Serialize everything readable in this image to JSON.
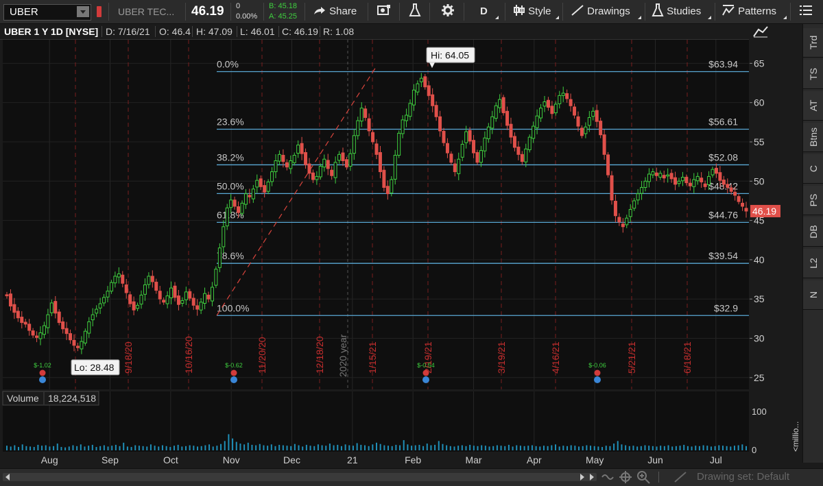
{
  "toolbar": {
    "symbol": "UBER",
    "description": "UBER TEC...",
    "last_price": "46.19",
    "net_change": "0",
    "net_change_pct": "0.00%",
    "bid": "B: 45.18",
    "ask": "A: 45.25",
    "share_label": "Share",
    "aggregation": "D",
    "style_label": "Style",
    "drawings_label": "Drawings",
    "studies_label": "Studies",
    "patterns_label": "Patterns",
    "colors": {
      "bid": "#3fcf3f",
      "ask": "#3fcf3f",
      "accent": "#ffffff"
    }
  },
  "header": {
    "title": "UBER 1 Y 1D [NYSE]",
    "date": "D: 7/16/21",
    "open": "O: 46.4",
    "high": "H: 47.09",
    "low": "L: 46.01",
    "close": "C: 46.19",
    "range": "R: 1.08"
  },
  "chart_data": {
    "type": "candlestick",
    "ylim": [
      23.5,
      68
    ],
    "yticks": [
      "25",
      "30",
      "35",
      "40",
      "45",
      "50",
      "55",
      "60",
      "65"
    ],
    "price_tag": "46.19",
    "hi_label": "Hi: 64.05",
    "lo_label": "Lo: 28.48",
    "year_label": "2020 year",
    "fib_levels": [
      {
        "pct": "0.0%",
        "price": "$63.94",
        "value": 63.94
      },
      {
        "pct": "23.6%",
        "price": "$56.61",
        "value": 56.61
      },
      {
        "pct": "38.2%",
        "price": "$52.08",
        "value": 52.08
      },
      {
        "pct": "50.0%",
        "price": "$48.42",
        "value": 48.42
      },
      {
        "pct": "61.8%",
        "price": "$44.76",
        "value": 44.76
      },
      {
        "pct": "78.6%",
        "price": "$39.54",
        "value": 39.54
      },
      {
        "pct": "100.0%",
        "price": "$32.9",
        "value": 32.9
      }
    ],
    "date_markers": [
      "8/",
      "9/18/20",
      "10/16/20",
      "11/20/20",
      "12/18/20",
      "1/15/21",
      "2/19/21",
      "3/19/21",
      "4/16/21",
      "5/21/21",
      "6/18/21"
    ],
    "months": [
      "Aug",
      "Sep",
      "Oct",
      "Nov",
      "Dec",
      "21",
      "Feb",
      "Mar",
      "Apr",
      "May",
      "Jun",
      "Jul"
    ],
    "earnings_events": [
      {
        "label": "$-1.02"
      },
      {
        "label": "$-0.62"
      },
      {
        "label": "$-0.54"
      },
      {
        "label": "$-0.06"
      }
    ],
    "closes": [
      35.4,
      34.1,
      33.3,
      32.6,
      32.0,
      31.8,
      31.0,
      30.4,
      30.1,
      30.7,
      31.6,
      33.0,
      34.5,
      33.2,
      32.0,
      31.2,
      30.6,
      29.8,
      29.1,
      28.8,
      29.6,
      30.9,
      32.1,
      33.0,
      33.7,
      34.4,
      35.2,
      36.0,
      37.1,
      37.9,
      38.2,
      37.0,
      35.8,
      34.4,
      33.6,
      34.2,
      35.5,
      36.8,
      37.9,
      37.2,
      36.1,
      35.0,
      34.6,
      35.4,
      36.4,
      35.2,
      34.3,
      34.8,
      35.9,
      35.1,
      34.2,
      33.7,
      34.6,
      35.7,
      35.0,
      36.5,
      38.8,
      41.5,
      44.2,
      46.6,
      47.6,
      46.8,
      46.0,
      47.2,
      48.4,
      48.0,
      49.0,
      50.1,
      49.3,
      48.6,
      49.9,
      51.2,
      52.6,
      53.4,
      52.5,
      51.8,
      52.6,
      53.3,
      54.6,
      53.5,
      52.1,
      51.0,
      50.2,
      50.6,
      51.9,
      52.8,
      51.6,
      50.7,
      52.4,
      53.4,
      52.6,
      51.8,
      53.5,
      55.8,
      57.7,
      59.3,
      58.1,
      56.4,
      55.0,
      53.4,
      51.2,
      49.2,
      48.4,
      50.2,
      53.3,
      56.1,
      57.8,
      58.4,
      59.9,
      61.6,
      62.4,
      63.1,
      62.0,
      60.9,
      59.6,
      58.2,
      56.4,
      54.9,
      53.6,
      52.4,
      51.2,
      52.8,
      54.7,
      56.3,
      55.1,
      53.6,
      52.4,
      53.9,
      55.5,
      56.9,
      58.2,
      59.6,
      60.4,
      58.7,
      57.1,
      55.6,
      54.3,
      53.4,
      52.5,
      54.1,
      55.6,
      57.0,
      58.3,
      59.3,
      60.1,
      59.4,
      58.6,
      59.8,
      60.9,
      61.2,
      60.5,
      59.6,
      58.4,
      57.0,
      55.8,
      56.9,
      58.1,
      58.9,
      57.6,
      55.9,
      53.4,
      50.8,
      47.6,
      45.6,
      44.8,
      44.2,
      45.3,
      46.4,
      47.5,
      48.4,
      49.2,
      50.0,
      50.9,
      51.2,
      50.7,
      51.0,
      50.4,
      50.8,
      50.3,
      49.6,
      50.0,
      50.5,
      49.8,
      49.4,
      50.2,
      50.6,
      49.9,
      49.3,
      50.6,
      51.5,
      51.0,
      50.1,
      49.6,
      49.2,
      48.7,
      48.2,
      47.4,
      46.8,
      46.19
    ]
  },
  "volume": {
    "label": "Volume",
    "value": "18,224,518",
    "axis_label": "100",
    "axis_zero": "0",
    "units": "<millio...",
    "values": [
      11,
      9,
      12,
      8,
      14,
      10,
      9,
      8,
      13,
      11,
      12,
      9,
      10,
      16,
      8,
      7,
      9,
      12,
      10,
      14,
      9,
      11,
      13,
      8,
      10,
      12,
      9,
      11,
      13,
      10,
      18,
      9,
      8,
      12,
      11,
      10,
      9,
      14,
      11,
      9,
      12,
      10,
      8,
      11,
      13,
      9,
      10,
      12,
      11,
      9,
      10,
      12,
      14,
      9,
      11,
      15,
      22,
      38,
      28,
      20,
      16,
      14,
      18,
      13,
      12,
      15,
      12,
      11,
      14,
      10,
      13,
      12,
      11,
      10,
      15,
      12,
      9,
      13,
      11,
      10,
      14,
      12,
      11,
      16,
      12,
      13,
      10,
      14,
      12,
      11,
      17,
      13,
      12,
      10,
      14,
      18,
      15,
      12,
      11,
      10,
      13,
      12,
      24,
      14,
      11,
      12,
      13,
      10,
      16,
      12,
      13,
      22,
      15,
      12,
      10,
      9,
      11,
      12,
      10,
      13,
      11,
      10,
      12,
      11,
      9,
      10,
      12,
      11,
      10,
      13,
      9,
      12,
      11,
      10,
      11,
      12,
      10,
      9,
      11,
      10,
      12,
      14,
      9,
      11,
      10,
      12,
      11,
      9,
      10,
      12,
      11,
      10,
      9,
      8,
      11,
      10,
      16,
      22,
      14,
      12,
      10,
      11,
      9,
      10,
      12,
      11,
      10,
      9,
      11,
      10,
      12,
      9,
      10,
      11,
      13,
      10,
      9,
      11,
      10,
      12,
      11,
      9,
      10,
      12,
      11,
      10,
      9,
      11,
      12,
      14,
      10
    ]
  },
  "side_tabs": [
    "Trd",
    "TS",
    "AT",
    "Btns",
    "C",
    "PS",
    "DB",
    "L2",
    "N"
  ],
  "bottom": {
    "drawing_set": "Drawing set: Default"
  }
}
